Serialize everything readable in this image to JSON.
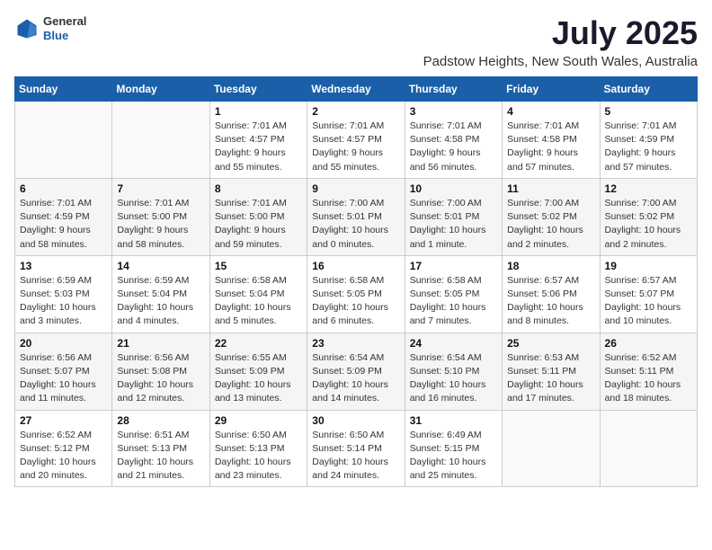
{
  "header": {
    "logo": {
      "line1": "General",
      "line2": "Blue"
    },
    "title": "July 2025",
    "location": "Padstow Heights, New South Wales, Australia"
  },
  "weekdays": [
    "Sunday",
    "Monday",
    "Tuesday",
    "Wednesday",
    "Thursday",
    "Friday",
    "Saturday"
  ],
  "weeks": [
    [
      {
        "day": "",
        "info": ""
      },
      {
        "day": "",
        "info": ""
      },
      {
        "day": "1",
        "info": "Sunrise: 7:01 AM\nSunset: 4:57 PM\nDaylight: 9 hours\nand 55 minutes."
      },
      {
        "day": "2",
        "info": "Sunrise: 7:01 AM\nSunset: 4:57 PM\nDaylight: 9 hours\nand 55 minutes."
      },
      {
        "day": "3",
        "info": "Sunrise: 7:01 AM\nSunset: 4:58 PM\nDaylight: 9 hours\nand 56 minutes."
      },
      {
        "day": "4",
        "info": "Sunrise: 7:01 AM\nSunset: 4:58 PM\nDaylight: 9 hours\nand 57 minutes."
      },
      {
        "day": "5",
        "info": "Sunrise: 7:01 AM\nSunset: 4:59 PM\nDaylight: 9 hours\nand 57 minutes."
      }
    ],
    [
      {
        "day": "6",
        "info": "Sunrise: 7:01 AM\nSunset: 4:59 PM\nDaylight: 9 hours\nand 58 minutes."
      },
      {
        "day": "7",
        "info": "Sunrise: 7:01 AM\nSunset: 5:00 PM\nDaylight: 9 hours\nand 58 minutes."
      },
      {
        "day": "8",
        "info": "Sunrise: 7:01 AM\nSunset: 5:00 PM\nDaylight: 9 hours\nand 59 minutes."
      },
      {
        "day": "9",
        "info": "Sunrise: 7:00 AM\nSunset: 5:01 PM\nDaylight: 10 hours\nand 0 minutes."
      },
      {
        "day": "10",
        "info": "Sunrise: 7:00 AM\nSunset: 5:01 PM\nDaylight: 10 hours\nand 1 minute."
      },
      {
        "day": "11",
        "info": "Sunrise: 7:00 AM\nSunset: 5:02 PM\nDaylight: 10 hours\nand 2 minutes."
      },
      {
        "day": "12",
        "info": "Sunrise: 7:00 AM\nSunset: 5:02 PM\nDaylight: 10 hours\nand 2 minutes."
      }
    ],
    [
      {
        "day": "13",
        "info": "Sunrise: 6:59 AM\nSunset: 5:03 PM\nDaylight: 10 hours\nand 3 minutes."
      },
      {
        "day": "14",
        "info": "Sunrise: 6:59 AM\nSunset: 5:04 PM\nDaylight: 10 hours\nand 4 minutes."
      },
      {
        "day": "15",
        "info": "Sunrise: 6:58 AM\nSunset: 5:04 PM\nDaylight: 10 hours\nand 5 minutes."
      },
      {
        "day": "16",
        "info": "Sunrise: 6:58 AM\nSunset: 5:05 PM\nDaylight: 10 hours\nand 6 minutes."
      },
      {
        "day": "17",
        "info": "Sunrise: 6:58 AM\nSunset: 5:05 PM\nDaylight: 10 hours\nand 7 minutes."
      },
      {
        "day": "18",
        "info": "Sunrise: 6:57 AM\nSunset: 5:06 PM\nDaylight: 10 hours\nand 8 minutes."
      },
      {
        "day": "19",
        "info": "Sunrise: 6:57 AM\nSunset: 5:07 PM\nDaylight: 10 hours\nand 10 minutes."
      }
    ],
    [
      {
        "day": "20",
        "info": "Sunrise: 6:56 AM\nSunset: 5:07 PM\nDaylight: 10 hours\nand 11 minutes."
      },
      {
        "day": "21",
        "info": "Sunrise: 6:56 AM\nSunset: 5:08 PM\nDaylight: 10 hours\nand 12 minutes."
      },
      {
        "day": "22",
        "info": "Sunrise: 6:55 AM\nSunset: 5:09 PM\nDaylight: 10 hours\nand 13 minutes."
      },
      {
        "day": "23",
        "info": "Sunrise: 6:54 AM\nSunset: 5:09 PM\nDaylight: 10 hours\nand 14 minutes."
      },
      {
        "day": "24",
        "info": "Sunrise: 6:54 AM\nSunset: 5:10 PM\nDaylight: 10 hours\nand 16 minutes."
      },
      {
        "day": "25",
        "info": "Sunrise: 6:53 AM\nSunset: 5:11 PM\nDaylight: 10 hours\nand 17 minutes."
      },
      {
        "day": "26",
        "info": "Sunrise: 6:52 AM\nSunset: 5:11 PM\nDaylight: 10 hours\nand 18 minutes."
      }
    ],
    [
      {
        "day": "27",
        "info": "Sunrise: 6:52 AM\nSunset: 5:12 PM\nDaylight: 10 hours\nand 20 minutes."
      },
      {
        "day": "28",
        "info": "Sunrise: 6:51 AM\nSunset: 5:13 PM\nDaylight: 10 hours\nand 21 minutes."
      },
      {
        "day": "29",
        "info": "Sunrise: 6:50 AM\nSunset: 5:13 PM\nDaylight: 10 hours\nand 23 minutes."
      },
      {
        "day": "30",
        "info": "Sunrise: 6:50 AM\nSunset: 5:14 PM\nDaylight: 10 hours\nand 24 minutes."
      },
      {
        "day": "31",
        "info": "Sunrise: 6:49 AM\nSunset: 5:15 PM\nDaylight: 10 hours\nand 25 minutes."
      },
      {
        "day": "",
        "info": ""
      },
      {
        "day": "",
        "info": ""
      }
    ]
  ]
}
